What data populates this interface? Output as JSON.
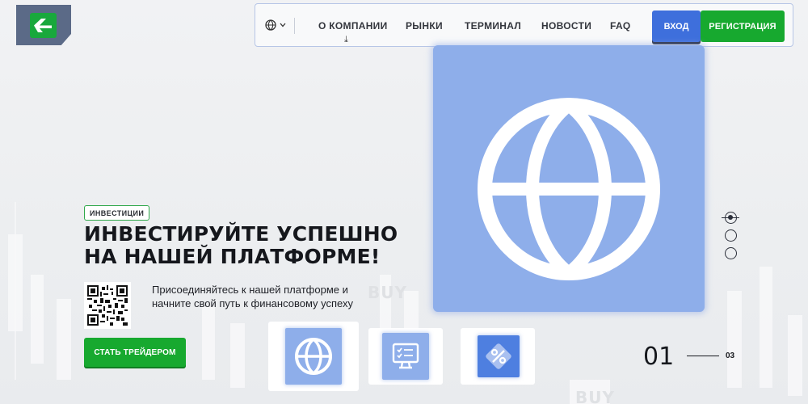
{
  "nav": {
    "items": [
      "О КОМПАНИИ",
      "РЫНКИ",
      "ТЕРМИНАЛ",
      "НОВОСТИ",
      "FAQ"
    ],
    "login_label": "ВХОД",
    "register_label": "РЕГИСТРАЦИЯ",
    "language_icon": "globe-icon"
  },
  "hero": {
    "badge": "ИНВЕСТИЦИИ",
    "title_line1": "ИНВЕСТИРУЙТЕ УСПЕШНО",
    "title_line2": "НА НАШЕЙ ПЛАТФОРМЕ!",
    "subtitle_line1": "Присоединяйтесь к нашей платформе и",
    "subtitle_line2": "начните свой путь к финансовому успеху",
    "cta_label": "СТАТЬ ТРЕЙДЕРОМ",
    "image_icon": "globe-icon"
  },
  "background_words": [
    "BUY",
    "BUY"
  ],
  "thumbnails": [
    {
      "icon": "globe-icon"
    },
    {
      "icon": "monitor-checklist-icon"
    },
    {
      "icon": "percent-icon"
    }
  ],
  "slider": {
    "current": "01",
    "total": "03"
  },
  "colors": {
    "brand_green": "#17a92f",
    "login_blue": "#3e6fdc",
    "hero_blue": "#8eaeea"
  }
}
